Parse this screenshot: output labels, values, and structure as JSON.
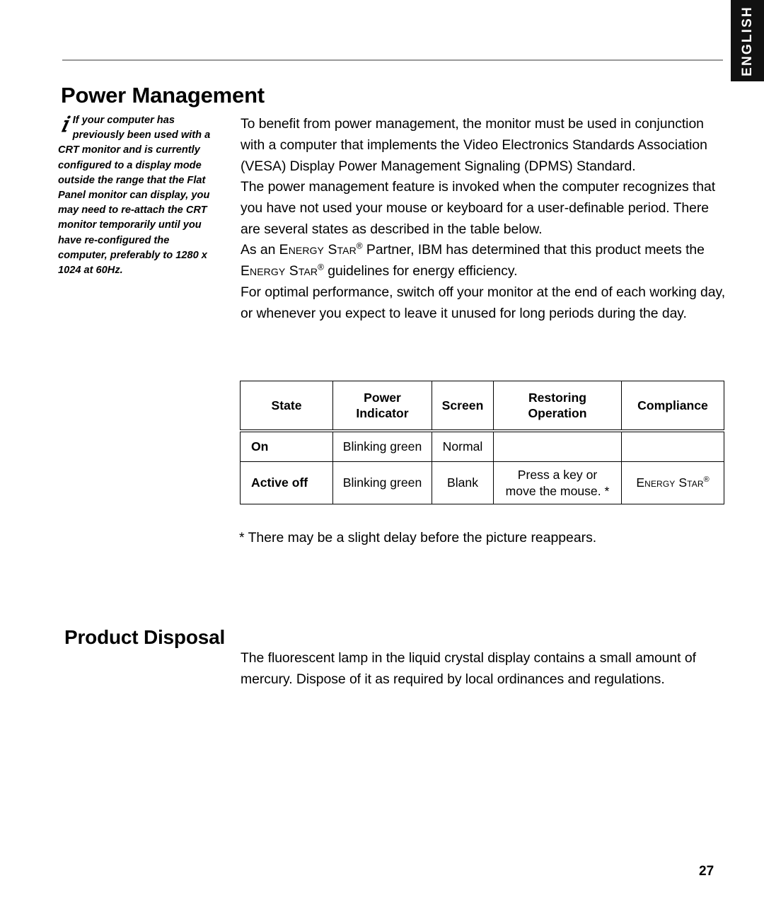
{
  "language_tab": {
    "label": "ENGLISH"
  },
  "sections": {
    "power_management": {
      "heading": "Power Management",
      "note": {
        "icon": "info-italic-i-icon",
        "text": "If your computer has previously been used with a CRT monitor and is currently configured to a display mode outside the range that the Flat Panel monitor can display, you may need to re-attach the CRT monitor temporarily until you have re-configured the computer, preferably to 1280 x 1024 at 60Hz."
      },
      "paragraphs": {
        "p1": "To benefit from power management, the monitor must be used in conjunction with a computer that implements the Video Electronics Standards Association (VESA) Display Power Management Signaling (DPMS) Standard.",
        "p2": "The power management feature is invoked when the computer recognizes that you have not used your mouse or keyboard for a user-definable period. There are several states as described in the table below.",
        "p3_part1": "As an ",
        "p3_energy_star_1": "Energy Star",
        "p3_part2": " Partner, IBM has determined that this product meets the ",
        "p3_energy_star_2": "Energy Star",
        "p3_part3": " guidelines for energy efficiency.",
        "p4": "For optimal performance, switch off your monitor at the end of each working day, or whenever you expect to leave it unused for long periods during the day."
      },
      "table": {
        "headers": [
          "State",
          "Power Indicator",
          "Screen",
          "Restoring Operation",
          "Compliance"
        ],
        "headers_lines": {
          "state": "State",
          "power_line1": "Power",
          "power_line2": "Indicator",
          "screen": "Screen",
          "restoring_line1": "Restoring",
          "restoring_line2": "Operation",
          "compliance": "Compliance"
        },
        "rows": [
          {
            "state": "On",
            "power_indicator": "Blinking green",
            "screen": "Normal",
            "restoring_operation": "",
            "compliance": ""
          },
          {
            "state": "Active off",
            "power_indicator": "Blinking green",
            "screen": "Blank",
            "restoring_line1": "Press a key or",
            "restoring_line2": "move the mouse. *",
            "compliance": "Energy Star"
          }
        ]
      },
      "footnote": "* There may be a slight delay before the picture reappears."
    },
    "product_disposal": {
      "heading": "Product Disposal",
      "paragraph": "The fluorescent lamp in the liquid crystal display contains a small amount of mercury. Dispose of it as required by local ordinances and regulations."
    }
  },
  "registered_mark": "®",
  "page_number": "27",
  "colors": {
    "tab_background": "#111111",
    "tab_text": "#ffffff",
    "rule": "#999999",
    "text": "#000000"
  }
}
